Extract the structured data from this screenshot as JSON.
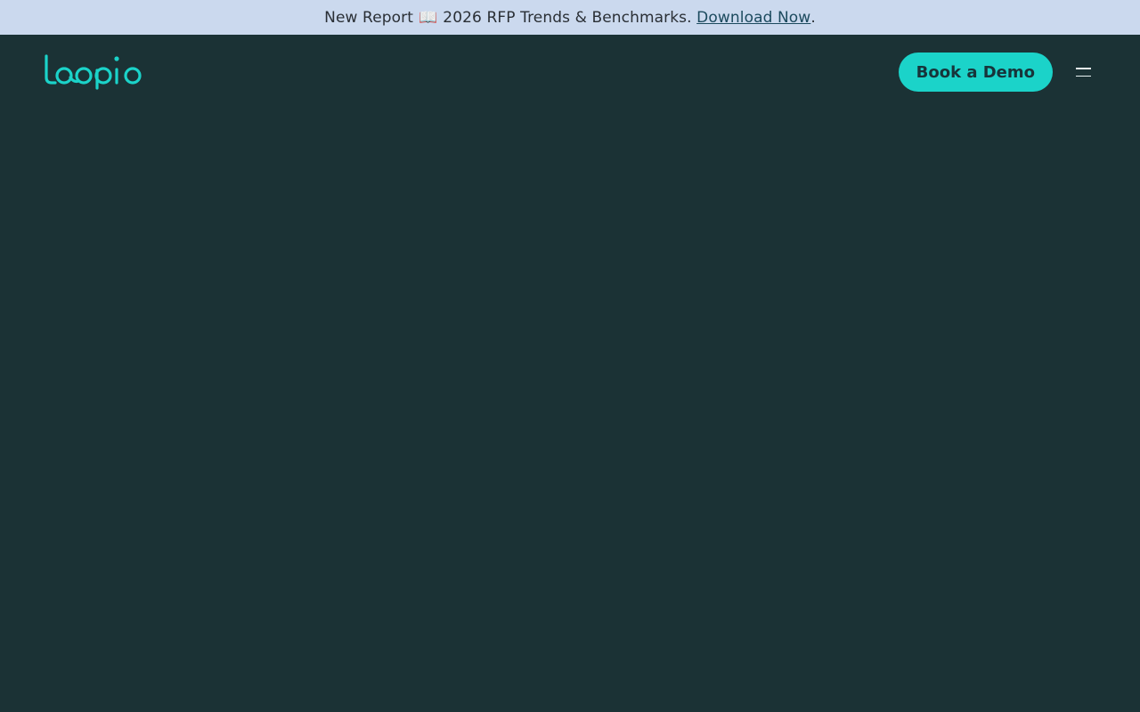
{
  "announcement": {
    "prefix": "New Report",
    "book_icon": "📖",
    "title": "2026 RFP Trends & Benchmarks.",
    "link_label": "Download Now",
    "suffix": "."
  },
  "header": {
    "logo_text": "loopio",
    "cta_label": "Book a Demo",
    "menu_icon": "hamburger-menu-icon"
  },
  "colors": {
    "page_background": "#1b3235",
    "banner_background": "#cbd9ee",
    "brand_teal": "#1bd3c9"
  }
}
